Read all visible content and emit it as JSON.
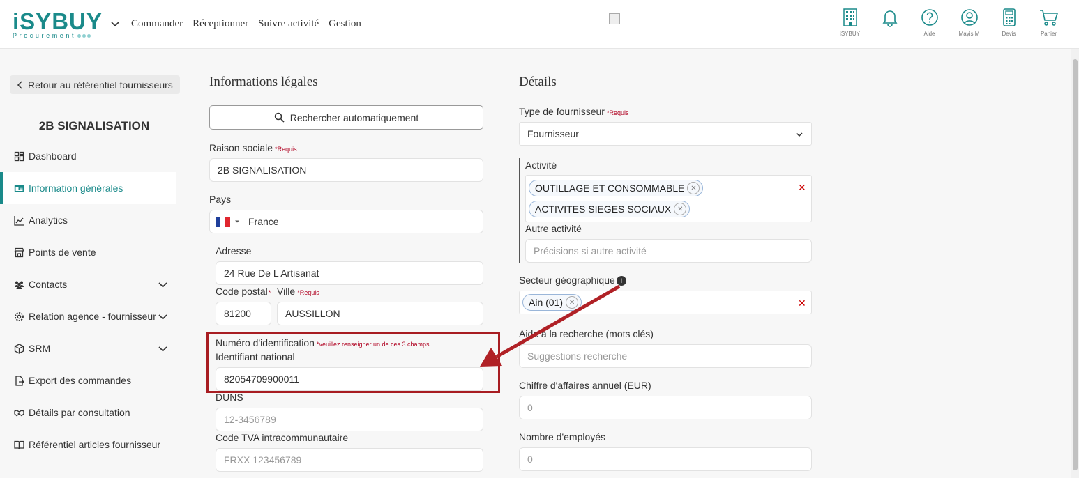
{
  "header": {
    "logo_main": "iSYBUY",
    "logo_sub": "Procurement",
    "nav": [
      "Commander",
      "Réceptionner",
      "Suivre activité",
      "Gestion"
    ],
    "icons": [
      {
        "name": "building-icon",
        "label": "iSYBUY"
      },
      {
        "name": "bell-icon",
        "label": ""
      },
      {
        "name": "help-icon",
        "label": "Aide"
      },
      {
        "name": "user-icon",
        "label": "Mayis M"
      },
      {
        "name": "calculator-icon",
        "label": "Devis"
      },
      {
        "name": "cart-icon",
        "label": "Panier"
      }
    ]
  },
  "sidebar": {
    "back_label": "Retour au référentiel fournisseurs",
    "company": "2B SIGNALISATION",
    "items": [
      {
        "label": "Dashboard",
        "icon": "dashboard-icon"
      },
      {
        "label": "Information générales",
        "icon": "id-card-icon",
        "active": true
      },
      {
        "label": "Analytics",
        "icon": "chart-line-icon"
      },
      {
        "label": "Points de vente",
        "icon": "store-icon"
      },
      {
        "label": "Contacts",
        "icon": "users-icon",
        "expandable": true
      },
      {
        "label": "Relation agence - fournisseur",
        "icon": "gear-icon",
        "expandable": true
      },
      {
        "label": "SRM",
        "icon": "box-icon",
        "expandable": true
      },
      {
        "label": "Export des commandes",
        "icon": "export-icon"
      },
      {
        "label": "Détails par consultation",
        "icon": "handshake-icon"
      },
      {
        "label": "Référentiel articles fournisseur",
        "icon": "book-icon"
      }
    ]
  },
  "legal": {
    "title": "Informations légales",
    "search_label": "Rechercher automatiquement",
    "raison_label": "Raison sociale",
    "required": "*Requis",
    "raison_value": "2B SIGNALISATION",
    "pays_label": "Pays",
    "pays_value": "France",
    "adresse_label": "Adresse",
    "adresse_value": "24 Rue De L Artisanat",
    "cp_label": "Code postal",
    "cp_star": "*",
    "cp_value": "81200",
    "ville_label": "Ville",
    "ville_value": "AUSSILLON",
    "num_label": "Numéro d'identification",
    "num_hint": "*veuillez renseigner un de ces 3 champs",
    "national_label": "Identifiant national",
    "national_value": "82054709900011",
    "duns_label": "DUNS",
    "duns_placeholder": "12-3456789",
    "tva_label": "Code TVA intracommunautaire",
    "tva_placeholder": "FRXX 123456789"
  },
  "details": {
    "title": "Détails",
    "type_label": "Type de fournisseur",
    "type_value": "Fournisseur",
    "activite_label": "Activité",
    "activite_chips": [
      "OUTILLAGE ET CONSOMMABLE",
      "ACTIVITES SIEGES SOCIAUX"
    ],
    "autre_label": "Autre activité",
    "autre_placeholder": "Précisions si autre activité",
    "secteur_label": "Secteur géographique",
    "secteur_chips": [
      "Ain (01)"
    ],
    "aide_label": "Aide à la recherche (mots clés)",
    "aide_placeholder": "Suggestions recherche",
    "ca_label": "Chiffre d'affaires annuel (EUR)",
    "ca_placeholder": "0",
    "employes_label": "Nombre d'employés",
    "employes_placeholder": "0"
  },
  "colors": {
    "brand": "#1a8a8a",
    "annotation": "#a81d22",
    "required": "#b00020"
  }
}
